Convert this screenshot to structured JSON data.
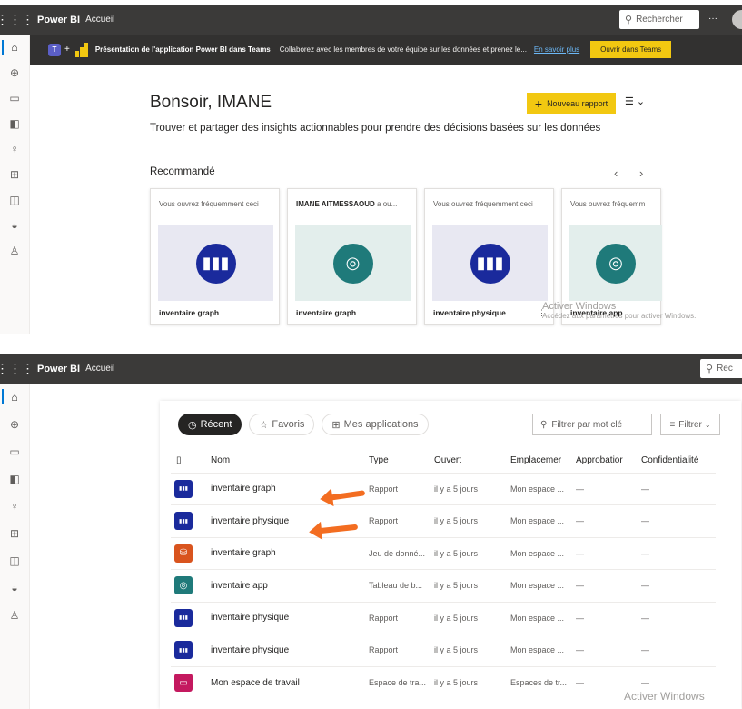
{
  "top": {
    "brand": "Power BI",
    "crumb": "Accueil",
    "search_placeholder": "Rechercher",
    "more": "···",
    "banner": {
      "title": "Présentation de l'application Power BI dans Teams",
      "desc": "Collaborez avec les membres de votre équipe sur les données et prenez le...",
      "link": "En savoir plus",
      "button": "Ouvrir dans Teams"
    },
    "greeting": "Bonsoir, IMANE",
    "subtitle": "Trouver et partager des insights actionnables pour prendre des décisions basées sur les données",
    "new_report": "Nouveau rapport",
    "recommended": "Recommandé",
    "prev": "‹",
    "next": "›",
    "cards": [
      {
        "header": "Vous ouvrez fréquemment ceci",
        "footer": "inventaire graph",
        "icon": "report-icon"
      },
      {
        "header_bold": "IMANE AITMESSAOUD",
        "header": " a ou...",
        "footer": "inventaire graph",
        "icon": "dashboard-icon"
      },
      {
        "header": "Vous ouvrez fréquemment ceci",
        "footer": "inventaire physique",
        "icon": "report-icon"
      },
      {
        "header": "Vous ouvrez fréquemm",
        "footer": "inventaire app",
        "icon": "dashboard-icon"
      }
    ],
    "watermark_title": "Activer Windows",
    "watermark_sub": "Accédez aux paramètres pour activer Windows."
  },
  "bottom": {
    "brand": "Power BI",
    "crumb": "Accueil",
    "search_placeholder": "Rec",
    "tabs": [
      "Récent",
      "Favoris",
      "Mes applications"
    ],
    "filter_placeholder": "Filtrer par mot clé",
    "filter_button": "Filtrer",
    "columns": [
      "Nom",
      "Type",
      "Ouvert",
      "Emplacemer",
      "Approbatior",
      "Confidentialité"
    ],
    "rows": [
      {
        "name": "inventaire graph",
        "type": "Rapport",
        "opened": "il y a 5 jours",
        "location": "Mon espace ...",
        "approval": "—",
        "conf": "—",
        "icon": "report"
      },
      {
        "name": "inventaire physique",
        "type": "Rapport",
        "opened": "il y a 5 jours",
        "location": "Mon espace ...",
        "approval": "—",
        "conf": "—",
        "icon": "report"
      },
      {
        "name": "inventaire graph",
        "type": "Jeu de donné...",
        "opened": "il y a 5 jours",
        "location": "Mon espace ...",
        "approval": "—",
        "conf": "—",
        "icon": "dataset"
      },
      {
        "name": "inventaire app",
        "type": "Tableau de b...",
        "opened": "il y a 5 jours",
        "location": "Mon espace ...",
        "approval": "—",
        "conf": "—",
        "icon": "dashboard"
      },
      {
        "name": "inventaire physique",
        "type": "Rapport",
        "opened": "il y a 5 jours",
        "location": "Mon espace ...",
        "approval": "—",
        "conf": "—",
        "icon": "report"
      },
      {
        "name": "inventaire physique",
        "type": "Rapport",
        "opened": "il y a 5 jours",
        "location": "Mon espace ...",
        "approval": "—",
        "conf": "—",
        "icon": "report"
      },
      {
        "name": "Mon espace de travail",
        "type": "Espace de tra...",
        "opened": "il y a 5 jours",
        "location": "Espaces de tr...",
        "approval": "—",
        "conf": "—",
        "icon": "workspace"
      }
    ],
    "watermark": "Activer Windows"
  },
  "colors": {
    "report": "#1a2a9c",
    "dataset": "#d9541e",
    "dashboard": "#1f7a7a",
    "workspace": "#c4195f",
    "accent": "#f2c811"
  }
}
